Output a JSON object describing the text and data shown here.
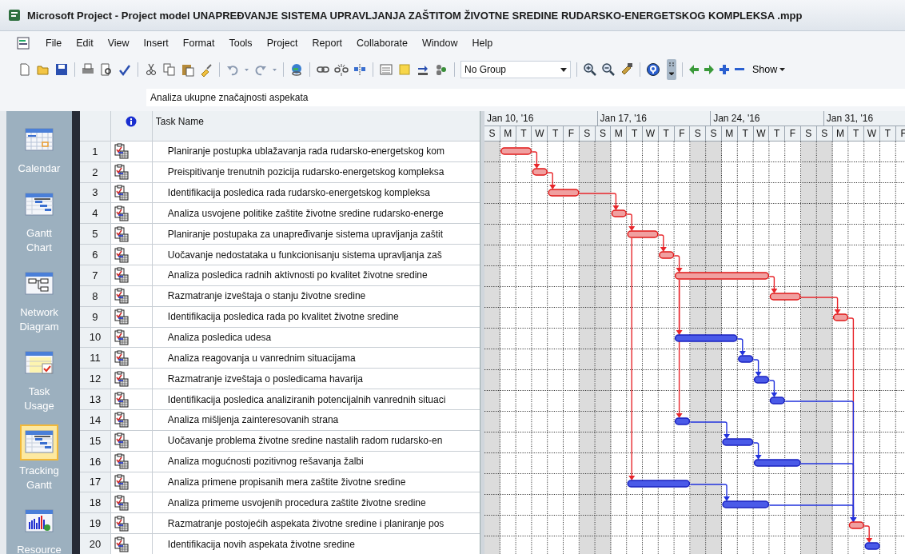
{
  "window": {
    "title": "Microsoft Project - Project model UNAPREĐVANJE SISTEMA UPRAVLJANJA ZAŠTITOM ŽIVOTNE SREDINE RUDARSKO-ENERGETSKOG KOMPLEKSA .mpp"
  },
  "menu": [
    "File",
    "Edit",
    "View",
    "Insert",
    "Format",
    "Tools",
    "Project",
    "Report",
    "Collaborate",
    "Window",
    "Help"
  ],
  "toolbar": {
    "group_dropdown": "No Group",
    "show_button": "Show"
  },
  "entry_bar": {
    "value": "Analiza ukupne značajnosti aspekata"
  },
  "view_bar": [
    {
      "label": "Calendar",
      "selected": false
    },
    {
      "label": "Gantt Chart",
      "selected": false
    },
    {
      "label": "Network Diagram",
      "selected": false
    },
    {
      "label": "Task Usage",
      "selected": false
    },
    {
      "label": "Tracking Gantt",
      "selected": true
    },
    {
      "label": "Resource",
      "selected": false
    }
  ],
  "table": {
    "column_header": "Task Name",
    "rows": [
      {
        "id": "1",
        "name": "Planiranje postupka ublažavanja rada rudarsko-energetskog kom",
        "critical": true
      },
      {
        "id": "2",
        "name": "Preispitivanje trenutnih pozicija rudarsko-energetskog kompleksa",
        "critical": true
      },
      {
        "id": "3",
        "name": "Identifikacija posledica rada rudarsko-energetskog kompleksa",
        "critical": true
      },
      {
        "id": "4",
        "name": "Analiza usvojene politike zaštite životne sredine rudarsko-energe",
        "critical": true
      },
      {
        "id": "5",
        "name": "Planiranje postupaka za unapređivanje sistema upravljanja zaštit",
        "critical": true
      },
      {
        "id": "6",
        "name": "Uočavanje nedostataka u funkcionisanju sistema upravljanja zaš",
        "critical": true
      },
      {
        "id": "7",
        "name": "Analiza posledica radnih aktivnosti po kvalitet životne sredine",
        "critical": true
      },
      {
        "id": "8",
        "name": "Razmatranje izveštaja o stanju životne sredine",
        "critical": true
      },
      {
        "id": "9",
        "name": "Identifikacija posledica rada po kvalitet životne sredine",
        "critical": true
      },
      {
        "id": "10",
        "name": "Analiza posledica udesa",
        "critical": false
      },
      {
        "id": "11",
        "name": "Analiza reagovanja u vanrednim situacijama",
        "critical": false
      },
      {
        "id": "12",
        "name": "Razmatranje izveštaja o posledicama havarija",
        "critical": false
      },
      {
        "id": "13",
        "name": "Identifikacija posledica analiziranih potencijalnih vanrednih situaci",
        "critical": false
      },
      {
        "id": "14",
        "name": "Analiza mišljenja zainteresovanih strana",
        "critical": false
      },
      {
        "id": "15",
        "name": "Uočavanje problema životne sredine nastalih radom rudarsko-en",
        "critical": false
      },
      {
        "id": "16",
        "name": "Analiza mogućnosti pozitivnog rešavanja žalbi",
        "critical": false
      },
      {
        "id": "17",
        "name": "Analiza primene propisanih mera zaštite životne sredine",
        "critical": false
      },
      {
        "id": "18",
        "name": "Analiza primeme usvojenih procedura zaštite životne sredine",
        "critical": false
      },
      {
        "id": "19",
        "name": "Razmatranje postojećih aspekata životne sredine i planiranje pos",
        "critical": true
      },
      {
        "id": "20",
        "name": "Identifikacija novih aspekata životne sredine",
        "critical": false
      }
    ]
  },
  "timescale": {
    "weeks": [
      "Jan 10, '16",
      "Jan 17, '16",
      "Jan 24, '16",
      "Jan 31, '16"
    ],
    "days": [
      "S",
      "M",
      "T",
      "W",
      "T",
      "F",
      "S",
      "S",
      "M",
      "T",
      "W",
      "T",
      "F",
      "S",
      "S",
      "M",
      "T",
      "W",
      "T",
      "F",
      "S",
      "S",
      "M",
      "T",
      "W",
      "T",
      "F"
    ]
  }
}
